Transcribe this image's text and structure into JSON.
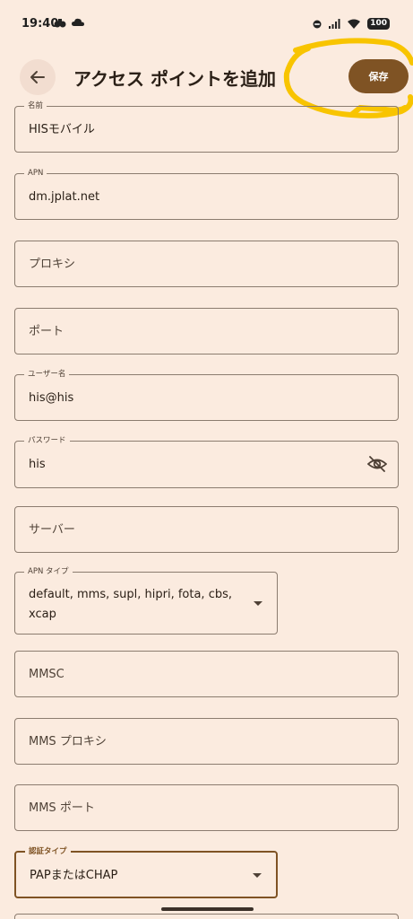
{
  "status_bar": {
    "time": "19:40",
    "battery": "100"
  },
  "header": {
    "title": "アクセス ポイントを追加",
    "save_label": "保存",
    "accent_color": "#7f5324",
    "highlight_color": "#f8c400"
  },
  "fields": {
    "name": {
      "label": "名前",
      "value": "HISモバイル"
    },
    "apn": {
      "label": "APN",
      "value": "dm.jplat.net"
    },
    "proxy": {
      "placeholder": "プロキシ"
    },
    "port": {
      "placeholder": "ポート"
    },
    "username": {
      "label": "ユーザー名",
      "value": "his@his"
    },
    "password": {
      "label": "パスワード",
      "value": "his"
    },
    "server": {
      "placeholder": "サーバー"
    },
    "apn_type": {
      "label": "APN タイプ",
      "value_line1": "default, mms, supl, hipri, fota, cbs,",
      "value_line2": "xcap"
    },
    "mmsc": {
      "placeholder": "MMSC"
    },
    "mms_proxy": {
      "placeholder": "MMS プロキシ"
    },
    "mms_port": {
      "placeholder": "MMS ポート"
    },
    "auth_type": {
      "label": "認証タイプ",
      "value": "PAPまたはCHAP"
    }
  },
  "icons": {
    "back": "arrow-left-icon",
    "password_toggle": "eye-off-icon",
    "dropdown": "caret-down-icon"
  }
}
